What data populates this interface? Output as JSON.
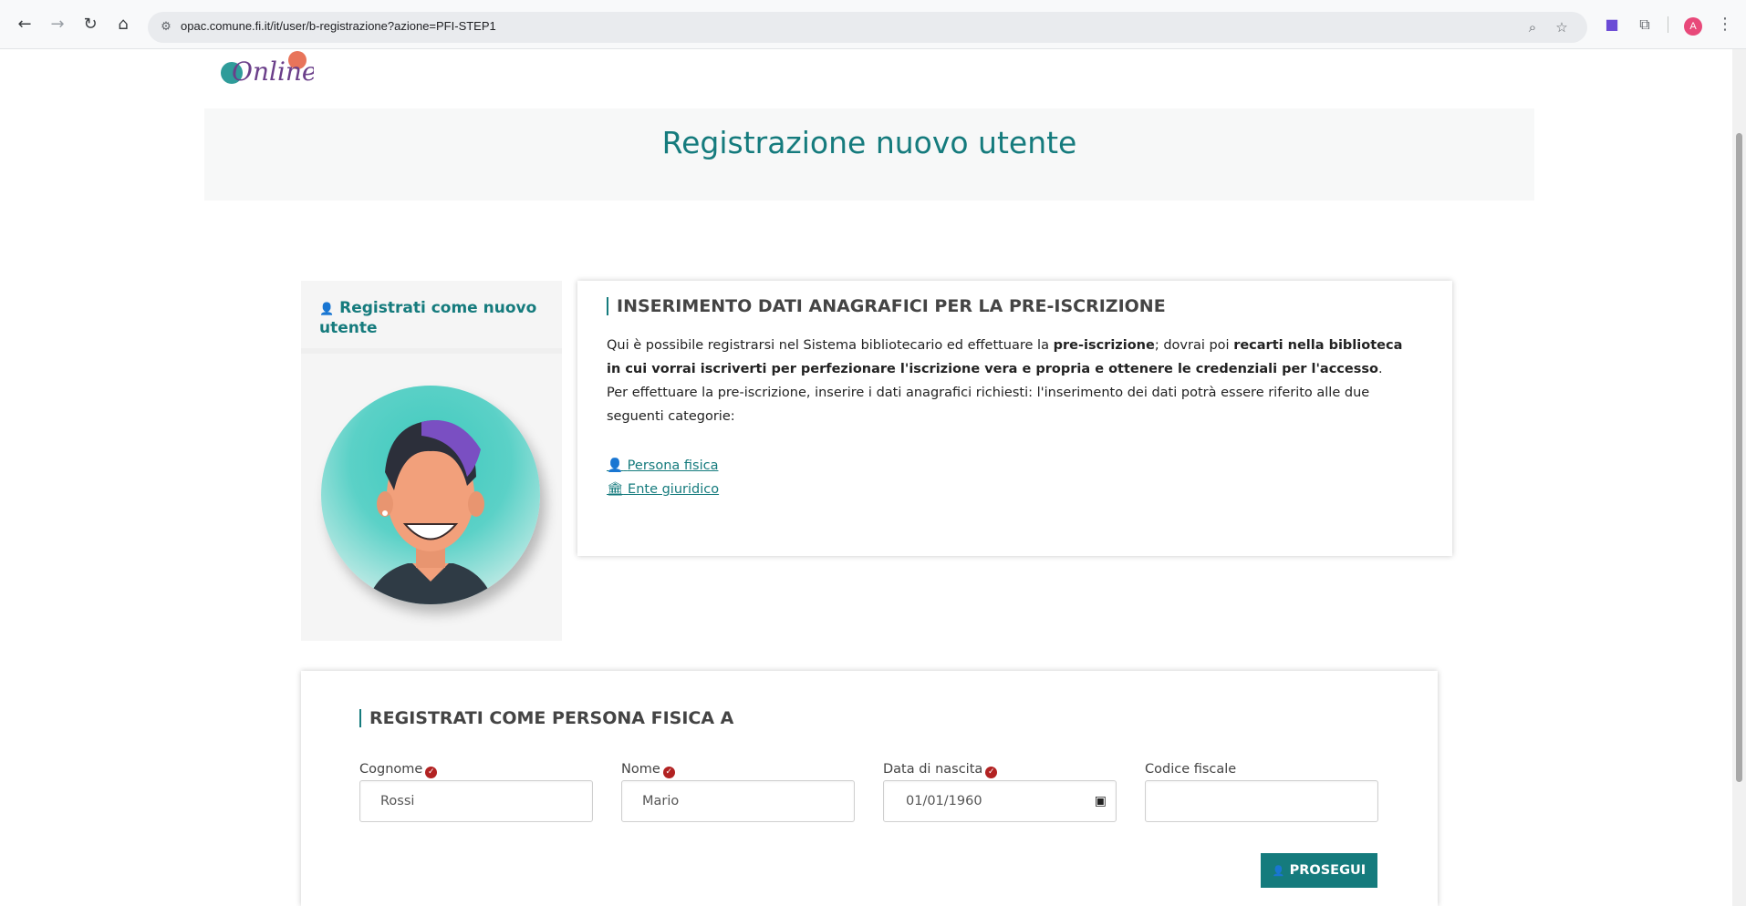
{
  "browser": {
    "url": "opac.comune.fi.it/it/user/b-registrazione?azione=PFI-STEP1",
    "avatar_letter": "A"
  },
  "icons": {
    "back": "back-arrow-icon",
    "forward": "forward-arrow-icon",
    "reload": "reload-icon",
    "home": "home-icon",
    "site_info": "tune-icon",
    "zoom": "zoom-icon",
    "bookmark": "star-icon",
    "extension_app": "app-icon",
    "extensions": "puzzle-icon",
    "menu": "kebab-menu-icon",
    "user": "user-icon",
    "institution": "institution-icon",
    "required": "check-badge-icon"
  },
  "logo": {
    "wordmark": "Online"
  },
  "banner": {
    "title": "Registrazione nuovo utente"
  },
  "sidebar": {
    "title": "Registrati come nuovo utente"
  },
  "info_card": {
    "heading": "INSERIMENTO DATI ANAGRAFICI PER LA PRE-ISCRIZIONE",
    "p1_a": "Qui è possibile registrarsi nel Sistema bibliotecario ed effettuare la ",
    "p1_b": "pre-iscrizione",
    "p1_c": "; dovrai poi ",
    "p1_d": "recarti nella biblioteca in cui vorrai iscriverti per perfezionare l'iscrizione vera e propria e ottenere le credenziali per l'accesso",
    "p1_e": ".",
    "p2": "Per effettuare la pre-iscrizione, inserire i dati anagrafici richiesti: l'inserimento dei dati potrà essere riferito alle due seguenti categorie:",
    "link_persona": "Persona fisica",
    "link_ente": "Ente giuridico"
  },
  "form": {
    "heading": "REGISTRATI COME PERSONA FISICA A",
    "cognome_label": "Cognome",
    "cognome_value": "Rossi",
    "nome_label": "Nome",
    "nome_value": "Mario",
    "data_label": "Data di nascita",
    "data_value": "01/01/1960",
    "cf_label": "Codice fiscale",
    "cf_value": "",
    "submit": "PROSEGUI"
  },
  "colors": {
    "accent": "#157b7d",
    "required": "#b22222"
  }
}
